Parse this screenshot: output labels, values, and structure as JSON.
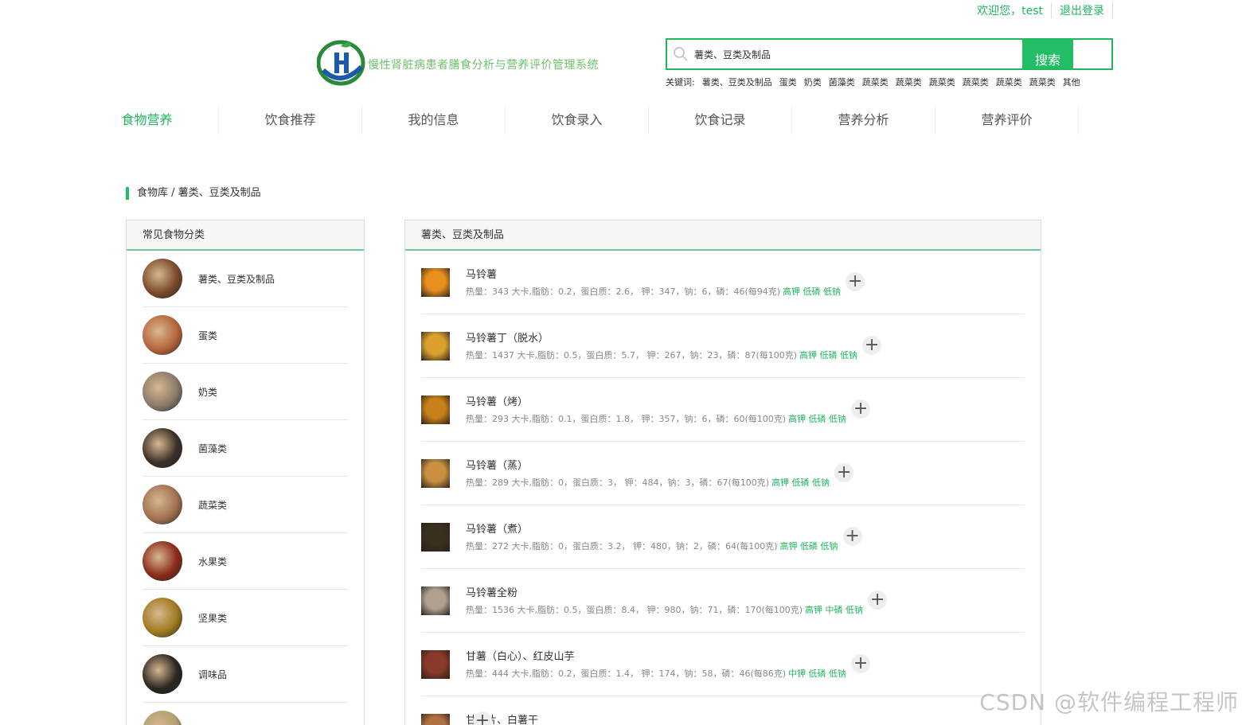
{
  "topbar": {
    "welcome": "欢迎您，test",
    "logout": "退出登录"
  },
  "logo": {
    "title": "慢性肾脏病患者膳食分析与营养评价管理系统"
  },
  "search": {
    "value": "薯类、豆类及制品",
    "button": "搜索"
  },
  "keywords": {
    "label": "关键词:",
    "items": [
      "薯类、豆类及制品",
      "蛋类",
      "奶类",
      "菌藻类",
      "蔬菜类",
      "蔬菜类",
      "蔬菜类",
      "蔬菜类",
      "蔬菜类",
      "蔬菜类",
      "其他"
    ]
  },
  "nav": {
    "items": [
      "食物营养",
      "饮食推荐",
      "我的信息",
      "饮食录入",
      "饮食记录",
      "营养分析",
      "营养评价"
    ],
    "active": "食物营养"
  },
  "breadcrumb": "食物库 / 薯类、豆类及制品",
  "sidebar": {
    "title": "常见食物分类",
    "items": [
      {
        "label": "薯类、豆类及制品",
        "color": "#7a4a2a"
      },
      {
        "label": "蛋类",
        "color": "#b5653a"
      },
      {
        "label": "奶类",
        "color": "#8a7a6a"
      },
      {
        "label": "菌藻类",
        "color": "#3a3028"
      },
      {
        "label": "蔬菜类",
        "color": "#a07050"
      },
      {
        "label": "水果类",
        "color": "#8a2a1a"
      },
      {
        "label": "坚果类",
        "color": "#a07a20"
      },
      {
        "label": "调味品",
        "color": "#2a2620"
      },
      {
        "label": "",
        "color": "#b0a070"
      }
    ]
  },
  "main": {
    "title": "薯类、豆类及制品",
    "foods": [
      {
        "name": "马铃薯",
        "info": "热量：343 大卡,脂肪：0.2，蛋白质：2.6，  钾：347，钠：6，磷：46(每94克)",
        "tags": "高钾 低磷 低钠",
        "color": "#e8901e"
      },
      {
        "name": "马铃薯丁（脱水）",
        "info": "热量：1437 大卡,脂肪：0.5，蛋白质：5.7，  钾：267，钠：23，磷：87(每100克)",
        "tags": "高钾 低磷 低钠",
        "color": "#d9a030"
      },
      {
        "name": "马铃薯（烤）",
        "info": "热量：293 大卡,脂肪：0.1，蛋白质：1.8，  钾：357，钠：6，磷：60(每100克)",
        "tags": "高钾 低磷 低钠",
        "color": "#c8801a"
      },
      {
        "name": "马铃薯（蒸）",
        "info": "热量：289 大卡,脂肪：0，蛋白质：3，  钾：484，钠：3，磷：67(每100克)",
        "tags": "高钾 低磷 低钠",
        "color": "#c89040"
      },
      {
        "name": "马铃薯（煮）",
        "info": "热量：272 大卡,脂肪：0，蛋白质：3.2，  钾：480，钠：2，磷：64(每100克)",
        "tags": "高钾 低磷 低钠",
        "color": "#3a3020"
      },
      {
        "name": "马铃薯全粉",
        "info": "热量：1536 大卡,脂肪：0.5，蛋白质：8.4，  钾：980，钠：71，磷：170(每100克)",
        "tags": "高钾 中磷 低钠",
        "color": "#b0a090"
      },
      {
        "name": "甘薯（白心）、红皮山芋",
        "info": "热量：444 大卡,脂肪：0.2，蛋白质：1.4，  钾：174，钠：58，磷：46(每86克)",
        "tags": "中钾 低磷 低钠",
        "color": "#8a3a2a"
      },
      {
        "name": "甘薯片、白薯干",
        "info": "",
        "tags": "",
        "color": "#b07040"
      }
    ]
  },
  "watermark": "CSDN @软件编程工程师"
}
